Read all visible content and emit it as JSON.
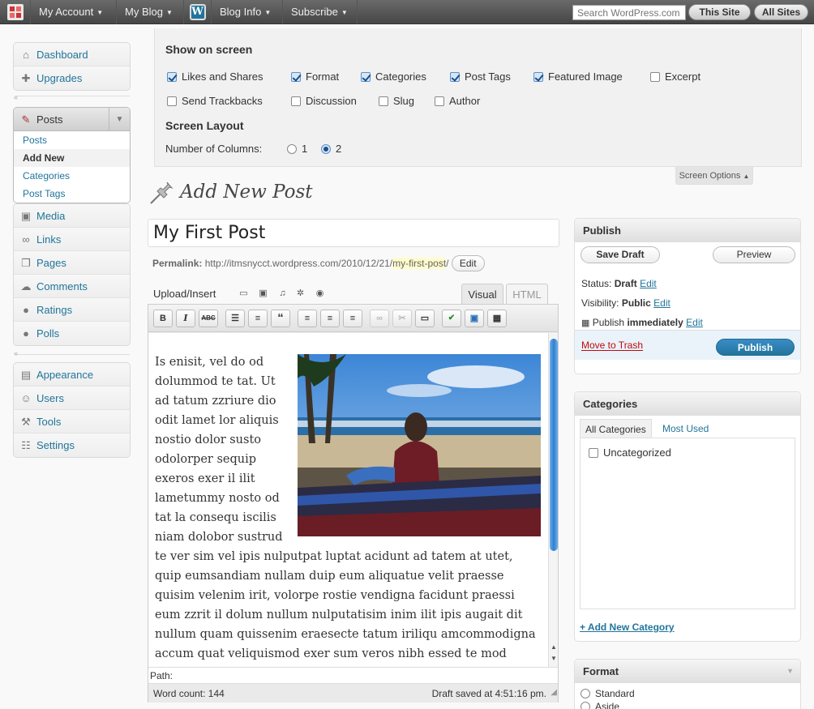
{
  "adminbar": {
    "my_account": "My Account",
    "my_blog": "My Blog",
    "blog_info": "Blog Info",
    "subscribe": "Subscribe",
    "search_placeholder": "Search WordPress.com",
    "this_site": "This Site",
    "all_sites": "All Sites"
  },
  "menu": {
    "dashboard": "Dashboard",
    "upgrades": "Upgrades",
    "posts": "Posts",
    "posts_sub": [
      "Posts",
      "Add New",
      "Categories",
      "Post Tags"
    ],
    "media": "Media",
    "links": "Links",
    "pages": "Pages",
    "comments": "Comments",
    "ratings": "Ratings",
    "polls": "Polls",
    "appearance": "Appearance",
    "users": "Users",
    "tools": "Tools",
    "settings": "Settings"
  },
  "screen_options": {
    "show_heading": "Show on screen",
    "checkboxes": [
      {
        "label": "Likes and Shares",
        "checked": true
      },
      {
        "label": "Format",
        "checked": true
      },
      {
        "label": "Categories",
        "checked": true
      },
      {
        "label": "Post Tags",
        "checked": true
      },
      {
        "label": "Featured Image",
        "checked": true
      },
      {
        "label": "Excerpt",
        "checked": false
      },
      {
        "label": "Send Trackbacks",
        "checked": false
      },
      {
        "label": "Discussion",
        "checked": false
      },
      {
        "label": "Slug",
        "checked": false
      },
      {
        "label": "Author",
        "checked": false
      }
    ],
    "layout_heading": "Screen Layout",
    "columns_label": "Number of Columns:",
    "columns": [
      {
        "label": "1",
        "selected": false
      },
      {
        "label": "2",
        "selected": true
      }
    ],
    "tab_label": "Screen Options"
  },
  "page_title": "Add New Post",
  "post_title": "My First Post",
  "permalink": {
    "label": "Permalink:",
    "base": "http://itmsnycct.wordpress.com/2010/12/21/",
    "slug": "my-first-post",
    "trail": "/",
    "edit": "Edit"
  },
  "editor": {
    "upload_label": "Upload/Insert",
    "tab_visual": "Visual",
    "tab_html": "HTML",
    "paragraph_wrap": "Is enisit, vel do od dolummod te tat. Ut ad tatum zzriure dio odit lamet lor aliquis nostio dolor susto odolorper sequip exeros exer il ilit lametummy nosto od tat la consequ iscilis niam dolobor",
    "paragraph_full": "sustrud te ver sim vel ipis nulputpat luptat acidunt ad tatem at utet, quip eumsandiam nullam duip eum aliquatue velit praesse quisim velenim irit, volorpe rostie vendigna facidunt praessi eum zzrit il dolum nullum nulputatisim inim ilit ipis augait dit nullum quam quissenim eraesecte tatum iriliqu amcommodigna accum quat veliquismod exer sum veros nibh essed te mod eliquam in",
    "path_label": "Path:",
    "word_count": "Word count: 144",
    "draft_saved": "Draft saved at 4:51:16 pm."
  },
  "publish": {
    "heading": "Publish",
    "save_draft": "Save Draft",
    "preview": "Preview",
    "status_label": "Status:",
    "status_value": "Draft",
    "visibility_label": "Visibility:",
    "visibility_value": "Public",
    "publish_label": "Publish",
    "publish_value": "immediately",
    "edit": "Edit",
    "move_to_trash": "Move to Trash",
    "publish_button": "Publish"
  },
  "categories": {
    "heading": "Categories",
    "tab_all": "All Categories",
    "tab_most_used": "Most Used",
    "items": [
      {
        "label": "Uncategorized",
        "checked": false
      }
    ],
    "add_new": "+ Add New Category"
  },
  "format": {
    "heading": "Format",
    "options": [
      "Standard",
      "Aside"
    ]
  },
  "colors": {
    "link": "#21759b",
    "publish_button": "#21759b",
    "trash": "#bc0b0b"
  }
}
